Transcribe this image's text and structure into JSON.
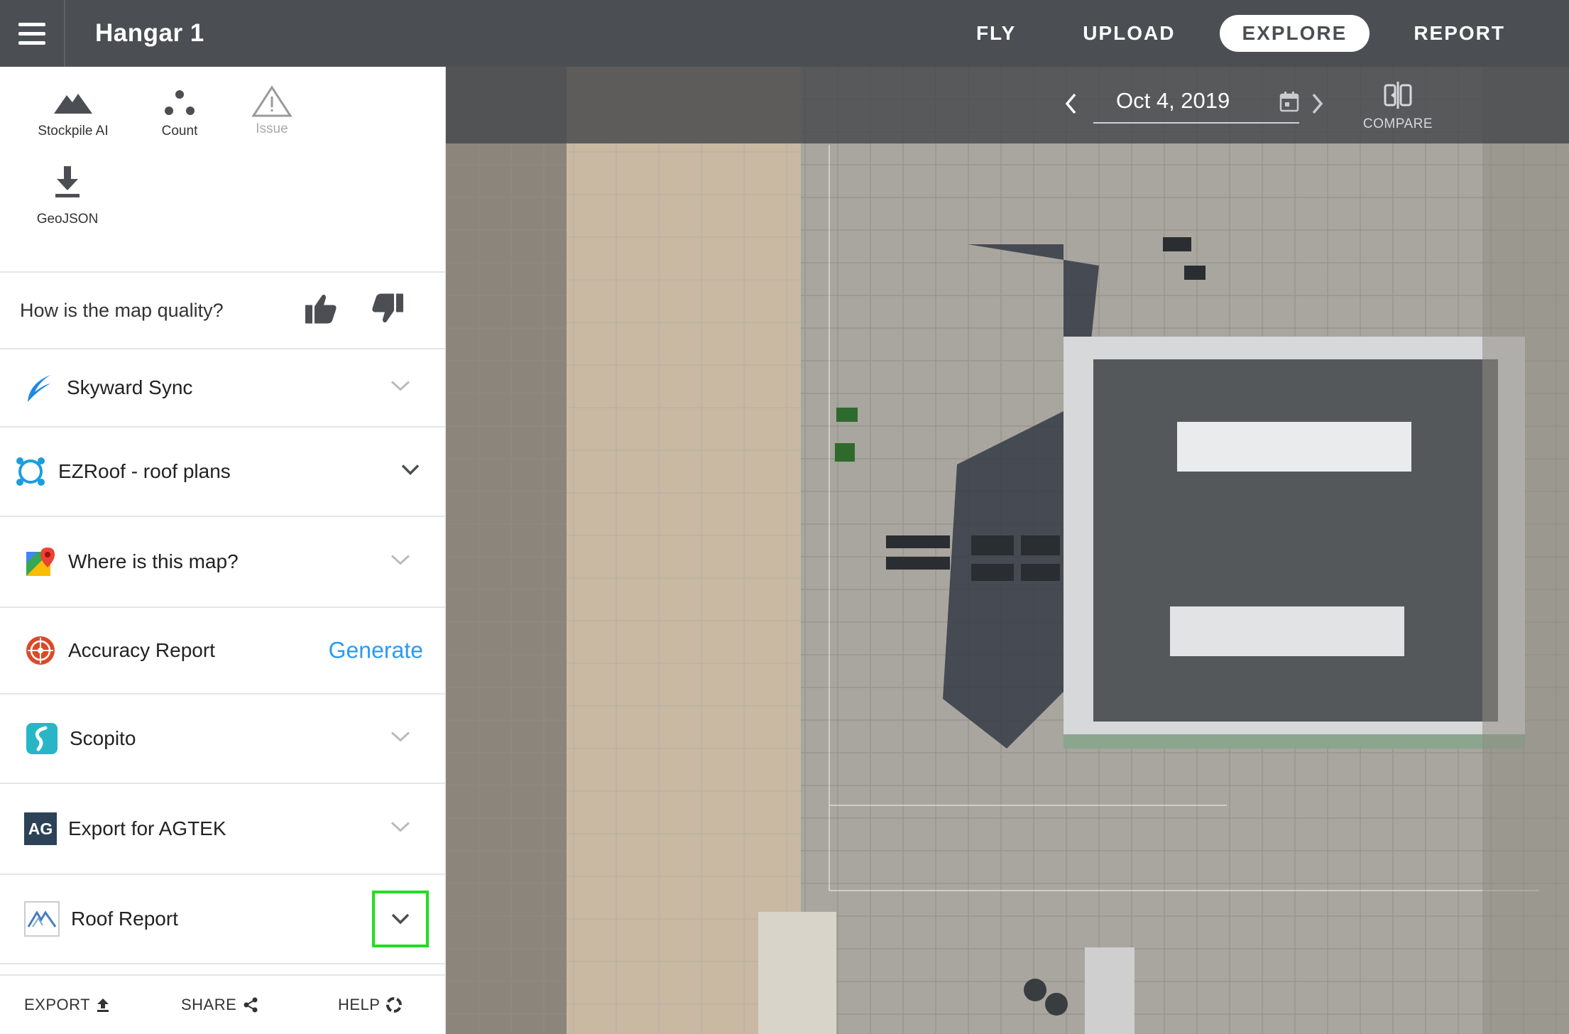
{
  "header": {
    "title": "Hangar 1",
    "nav": [
      {
        "label": "FLY",
        "active": false
      },
      {
        "label": "UPLOAD",
        "active": false
      },
      {
        "label": "EXPLORE",
        "active": true
      },
      {
        "label": "REPORT",
        "active": false
      }
    ]
  },
  "tools": [
    {
      "label": "Stockpile AI",
      "icon": "mountain-icon"
    },
    {
      "label": "Count",
      "icon": "dots-icon"
    },
    {
      "label": "Issue",
      "icon": "warning-icon"
    },
    {
      "label": "GeoJSON",
      "icon": "download-icon"
    }
  ],
  "quality": {
    "question": "How is the map quality?"
  },
  "integrations": [
    {
      "label": "Skyward Sync",
      "icon": "skyward-logo-icon"
    },
    {
      "label": "EZRoof - roof plans",
      "icon": "ezroof-logo-icon"
    },
    {
      "label": "Where is this map?",
      "icon": "google-maps-icon"
    },
    {
      "label": "Accuracy Report",
      "icon": "accuracy-target-icon",
      "action": "Generate"
    },
    {
      "label": "Scopito",
      "icon": "scopito-logo-icon"
    },
    {
      "label": "Export for AGTEK",
      "icon": "agtek-logo-icon",
      "logo_text": "AG"
    },
    {
      "label": "Roof Report",
      "icon": "roof-report-logo-icon"
    }
  ],
  "footer": {
    "export": "EXPORT",
    "share": "SHARE",
    "help": "HELP"
  },
  "map": {
    "date": "Oct 4, 2019",
    "compare": "COMPARE"
  },
  "colors": {
    "topbar": "#4b4f54",
    "accent": "#2b9af3",
    "highlight": "#22dd22"
  }
}
